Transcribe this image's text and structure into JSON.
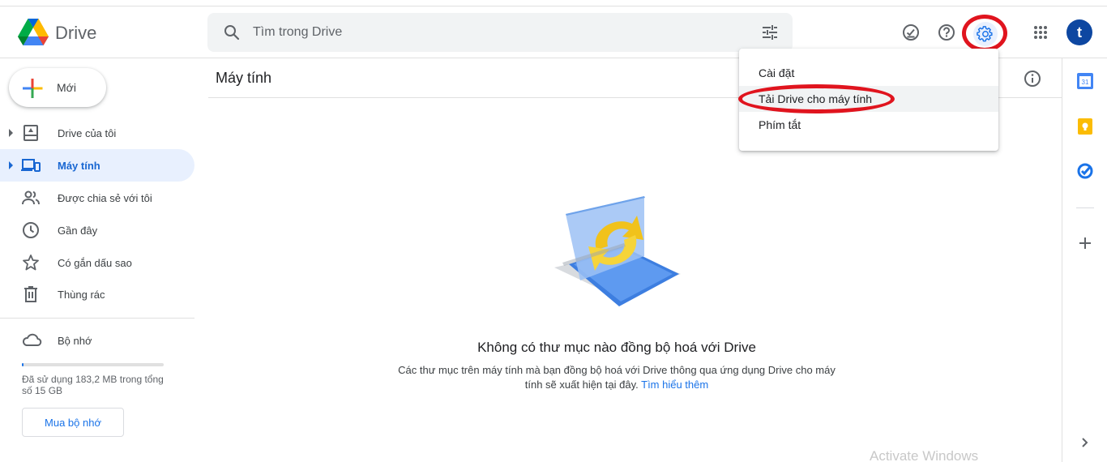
{
  "app": {
    "name": "Drive"
  },
  "search": {
    "placeholder": "Tìm trong Drive"
  },
  "header": {
    "avatar_letter": "t"
  },
  "new_button": {
    "label": "Mới"
  },
  "sidebar": {
    "items": [
      {
        "label": "Drive của tôi",
        "icon": "my-drive-icon",
        "has_caret": true,
        "active": false
      },
      {
        "label": "Máy tính",
        "icon": "computers-icon",
        "has_caret": true,
        "active": true
      },
      {
        "label": "Được chia sẻ với tôi",
        "icon": "shared-icon",
        "has_caret": false,
        "active": false
      },
      {
        "label": "Gần đây",
        "icon": "clock-icon",
        "has_caret": false,
        "active": false
      },
      {
        "label": "Có gắn dấu sao",
        "icon": "star-icon",
        "has_caret": false,
        "active": false
      },
      {
        "label": "Thùng rác",
        "icon": "trash-icon",
        "has_caret": false,
        "active": false
      }
    ],
    "storage": {
      "label": "Bộ nhớ",
      "usage_text": "Đã sử dụng 183,2 MB trong tổng số 15 GB",
      "used_fraction": 0.012,
      "buy_label": "Mua bộ nhớ"
    }
  },
  "main": {
    "title": "Máy tính",
    "empty_title": "Không có thư mục nào đồng bộ hoá với Drive",
    "empty_desc": "Các thư mục trên máy tính mà bạn đồng bộ hoá với Drive thông qua ứng dụng Drive cho máy tính sẽ xuất hiện tại đây.",
    "learn_more": "Tìm hiểu thêm"
  },
  "settings_menu": {
    "items": [
      {
        "label": "Cài đặt"
      },
      {
        "label": "Tải Drive cho máy tính"
      },
      {
        "label": "Phím tắt"
      }
    ]
  },
  "watermark": "Activate Windows",
  "colors": {
    "accent": "#1a73e8",
    "active_bg": "#e8f0fe",
    "highlight_ring": "#e0141e",
    "avatar": "#0d47a1"
  }
}
